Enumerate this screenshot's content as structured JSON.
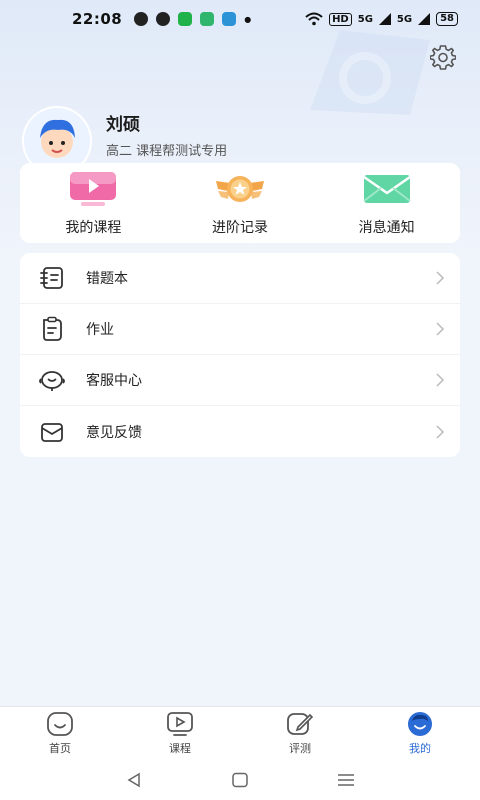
{
  "status_bar": {
    "time": "22:08",
    "network": "5G",
    "hd": "HD",
    "battery": "58"
  },
  "profile": {
    "name": "刘硕",
    "subtitle": "高二  课程帮测试专用"
  },
  "shortcuts": [
    {
      "label": "我的课程",
      "icon": "tv-play-icon",
      "color": "#f06aa8"
    },
    {
      "label": "进阶记录",
      "icon": "medal-icon",
      "color": "#f3a54a"
    },
    {
      "label": "消息通知",
      "icon": "envelope-icon",
      "color": "#5fd6a4"
    }
  ],
  "menu": [
    {
      "label": "错题本",
      "icon": "wrong-book-icon"
    },
    {
      "label": "作业",
      "icon": "homework-icon"
    },
    {
      "label": "客服中心",
      "icon": "headset-icon"
    },
    {
      "label": "意见反馈",
      "icon": "feedback-icon"
    }
  ],
  "tabs": [
    {
      "label": "首页",
      "icon": "home-icon",
      "active": false
    },
    {
      "label": "课程",
      "icon": "course-icon",
      "active": false
    },
    {
      "label": "评测",
      "icon": "edit-icon",
      "active": false
    },
    {
      "label": "我的",
      "icon": "profile-icon",
      "active": true
    }
  ],
  "colors": {
    "accent": "#2a6bd6",
    "background": "#f0f4fb"
  }
}
